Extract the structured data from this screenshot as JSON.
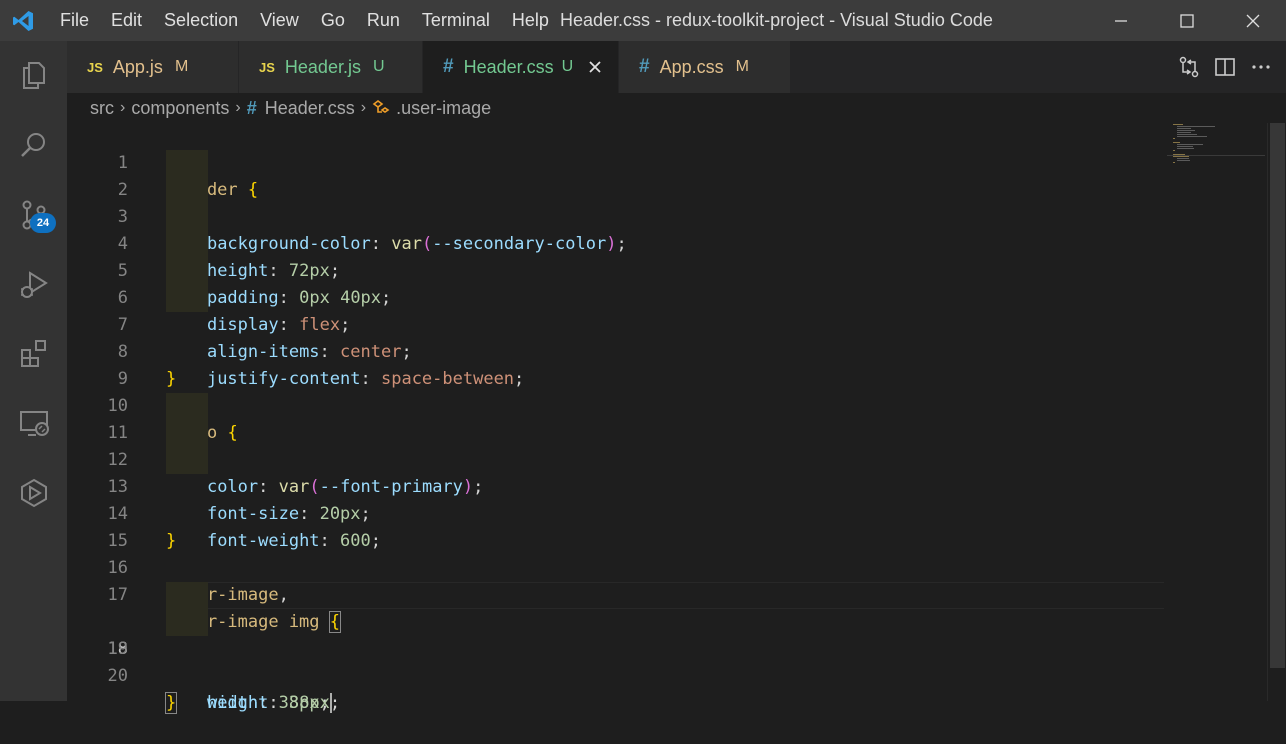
{
  "menu": [
    "File",
    "Edit",
    "Selection",
    "View",
    "Go",
    "Run",
    "Terminal",
    "Help"
  ],
  "window_title": "Header.css - redux-toolkit-project - Visual Studio Code",
  "activity_bar": {
    "icons": [
      "explorer-icon",
      "search-icon",
      "source-control-icon",
      "run-debug-icon",
      "extensions-icon",
      "remote-explorer-icon",
      "live-share-icon"
    ],
    "source_control_badge": "24"
  },
  "tabs": [
    {
      "icon": "JS",
      "label": "App.js",
      "status": "M",
      "active": false
    },
    {
      "icon": "JS",
      "label": "Header.js",
      "status": "U",
      "active": false
    },
    {
      "icon": "#",
      "label": "Header.css",
      "status": "U",
      "active": true
    },
    {
      "icon": "#",
      "label": "App.css",
      "status": "M",
      "active": false
    }
  ],
  "breadcrumb": {
    "items": [
      "src",
      "components",
      "Header.css",
      ".user-image"
    ],
    "file_icon": "#"
  },
  "editor": {
    "current_line": 18,
    "lines": [
      {
        "n": "1",
        "text": ".header {"
      },
      {
        "n": "2",
        "text": "    background-color: var(--secondary-color);"
      },
      {
        "n": "3",
        "text": "    height: 72px;"
      },
      {
        "n": "4",
        "text": "    padding: 0px 40px;"
      },
      {
        "n": "5",
        "text": "    display: flex;"
      },
      {
        "n": "6",
        "text": "    align-items: center;"
      },
      {
        "n": "7",
        "text": "    justify-content: space-between;"
      },
      {
        "n": "8",
        "text": "}"
      },
      {
        "n": "9",
        "text": ""
      },
      {
        "n": "10",
        "text": ".logo {"
      },
      {
        "n": "11",
        "text": "    color: var(--font-primary);"
      },
      {
        "n": "12",
        "text": "    font-size: 20px;"
      },
      {
        "n": "13",
        "text": "    font-weight: 600;"
      },
      {
        "n": "14",
        "text": "}"
      },
      {
        "n": "15",
        "text": ""
      },
      {
        "n": "16",
        "text": ".user-image,"
      },
      {
        "n": "17",
        "text": ".user-image img {"
      },
      {
        "n": "18",
        "text": "    width: 38px;"
      },
      {
        "n": "19",
        "text": "    height: 38px;"
      },
      {
        "n": "20",
        "text": "}"
      }
    ]
  },
  "colors": {
    "accent": "#0e70c0",
    "modified": "#e2c08d",
    "untracked": "#73c991",
    "selector": "#d7ba7d",
    "property": "#9cdcfe",
    "value": "#ce9178",
    "number": "#b5cea8"
  }
}
